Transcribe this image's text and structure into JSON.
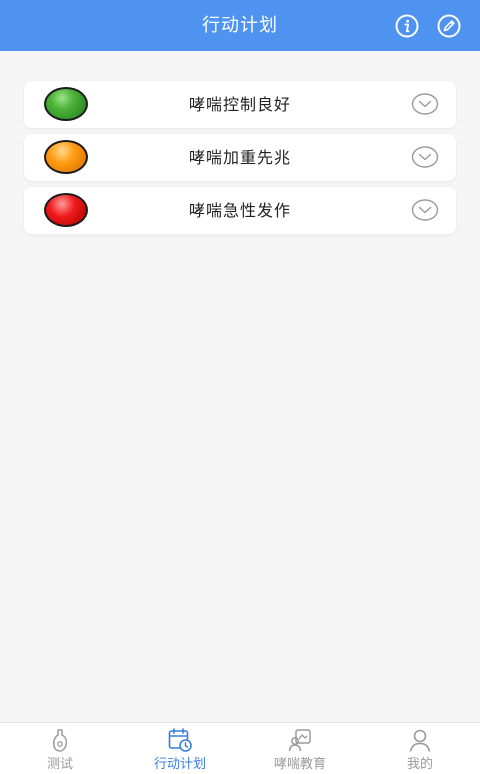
{
  "header": {
    "title": "行动计划",
    "info_icon": "info-icon",
    "edit_icon": "pencil-icon"
  },
  "plans": [
    {
      "label": "哮喘控制良好",
      "light": "green",
      "color": "#3fa82f"
    },
    {
      "label": "哮喘加重先兆",
      "light": "orange",
      "color": "#ff9a10"
    },
    {
      "label": "哮喘急性发作",
      "light": "red",
      "color": "#f01a1a"
    }
  ],
  "tabbar": {
    "active": "行动计划",
    "tabs": [
      {
        "label": "测试",
        "icon": "peak-flow-meter-icon"
      },
      {
        "label": "行动计划",
        "icon": "calendar-clock-icon"
      },
      {
        "label": "哮喘教育",
        "icon": "education-icon"
      },
      {
        "label": "我的",
        "icon": "person-icon"
      }
    ]
  },
  "colors": {
    "header_bg": "#4e93ef",
    "accent": "#3a7fe0",
    "inactive": "#9a9a9a",
    "page_bg": "#f5f5f5"
  }
}
